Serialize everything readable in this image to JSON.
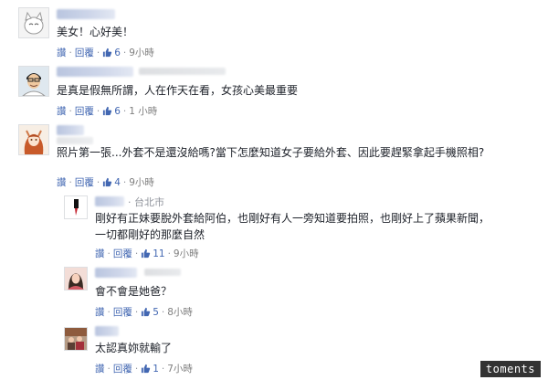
{
  "comments": [
    {
      "text": "美女！心好美！",
      "reply_label": "讚",
      "reply_link": "回覆",
      "likes": "6",
      "time": "9小時"
    },
    {
      "text": "是真是假無所謂，人在作天在看，女孩心美最重要",
      "reply_label": "讚",
      "reply_link": "回覆",
      "likes": "6",
      "time": "1 小時"
    },
    {
      "text": "照片第一張...外套不是還沒給嗎?當下怎麼知道女子要給外套、因此要趕緊拿起手機照相?",
      "reply_label": "讚",
      "reply_link": "回覆",
      "likes": "4",
      "time": "9小時"
    }
  ],
  "replies": [
    {
      "location": "台北市",
      "text": "剛好有正妹要脫外套給阿伯，也剛好有人一旁知道要拍照，也剛好上了蘋果新聞，一切都剛好的那麼自然",
      "reply_label": "讚",
      "reply_link": "回覆",
      "likes": "11",
      "time": "9小時"
    },
    {
      "text": "會不會是她爸？",
      "reply_label": "讚",
      "reply_link": "回覆",
      "likes": "5",
      "time": "8小時"
    },
    {
      "text": "太認真妳就輸了",
      "reply_label": "讚",
      "reply_link": "回覆",
      "likes": "1",
      "time": "7小時"
    }
  ],
  "watermark": "toments",
  "colors": {
    "link": "#4267b2",
    "meta": "#7f7f7f",
    "text": "#1d2129"
  }
}
